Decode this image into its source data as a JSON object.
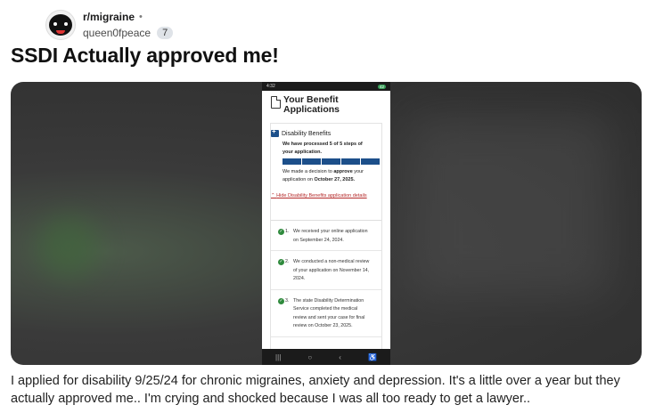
{
  "post": {
    "subreddit": "r/migraine",
    "separator": "•",
    "username": "queen0fpeace",
    "flair": "7",
    "title": "SSDI Actually approved me!",
    "body": "I applied for disability 9/25/24 for chronic migraines, anxiety and depression. It's a little over a year but they actually approved me.. I'm crying and shocked because I was all too ready to get a lawyer.."
  },
  "phone": {
    "status_time": "4:32",
    "status_badge": "42",
    "app_title": "Your Benefit Applications",
    "benefit_label": "Disability Benefits",
    "processed_text": "We have processed 5 of 5 steps of your application.",
    "progress_steps_completed": 5,
    "progress_steps_total": 5,
    "decision_prefix": "We made a decision to ",
    "decision_word": "approve",
    "decision_mid": " your application on ",
    "decision_date": "October 27, 2025.",
    "hide_link": "Hide Disability Benefits application details",
    "steps": [
      {
        "num": "1.",
        "text": "We received your online application on September 24, 2024."
      },
      {
        "num": "2.",
        "text": "We conducted a non-medical review of your application on November 14, 2024."
      },
      {
        "num": "3.",
        "text": "The state Disability Determination Service completed the medical review and sent your case for final review on October 23, 2025."
      }
    ],
    "nav": [
      "|||",
      "○",
      "‹",
      "♿"
    ]
  },
  "colors": {
    "progress": "#1c4f8a",
    "link": "#b52a2a",
    "check": "#2f8a3d"
  }
}
